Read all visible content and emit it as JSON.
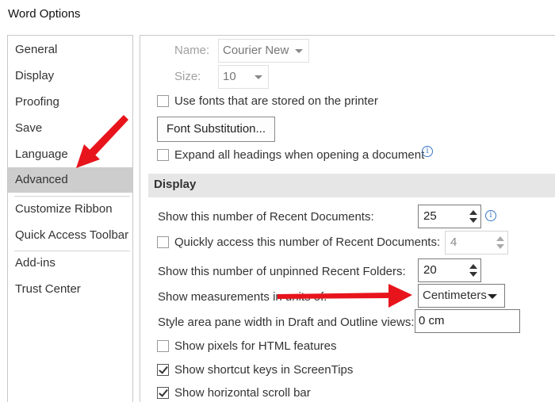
{
  "window": {
    "title": "Word Options"
  },
  "sidebar": {
    "items": [
      {
        "label": "General"
      },
      {
        "label": "Display"
      },
      {
        "label": "Proofing"
      },
      {
        "label": "Save"
      },
      {
        "label": "Language"
      },
      {
        "label": "Advanced"
      },
      {
        "label": "Customize Ribbon"
      },
      {
        "label": "Quick Access Toolbar"
      },
      {
        "label": "Add-ins"
      },
      {
        "label": "Trust Center"
      }
    ],
    "active": "Advanced"
  },
  "printing_fonts": {
    "name_label": "Name:",
    "name_value": "Courier New",
    "size_label": "Size:",
    "size_value": "10",
    "use_printer_fonts": {
      "label": "Use fonts that are stored on the printer",
      "checked": false
    },
    "font_substitution_button": "Font Substitution...",
    "expand_headings": {
      "label": "Expand all headings when opening a document",
      "checked": false
    }
  },
  "display": {
    "section_title": "Display",
    "recent_docs": {
      "label": "Show this number of Recent Documents:",
      "value": "25"
    },
    "quick_access_recent": {
      "label": "Quickly access this number of Recent Documents:",
      "value": "4",
      "checked": false
    },
    "recent_folders": {
      "label": "Show this number of unpinned Recent Folders:",
      "value": "20"
    },
    "measurement_units": {
      "label": "Show measurements in units of:",
      "value": "Centimeters"
    },
    "style_area_width": {
      "label": "Style area pane width in Draft and Outline views:",
      "value": "0 cm"
    },
    "show_pixels_html": {
      "label": "Show pixels for HTML features",
      "checked": false
    },
    "show_shortcut_keys": {
      "label": "Show shortcut keys in ScreenTips",
      "checked": true
    },
    "show_horizontal_scroll": {
      "label": "Show horizontal scroll bar",
      "checked": true
    }
  },
  "icons": {
    "info": "info-icon",
    "annotation_arrow": "red-arrow"
  },
  "colors": {
    "arrow_red": "#e8141c",
    "selected_nav": "#cdcdcd",
    "section_bg": "#e6e6e6"
  }
}
